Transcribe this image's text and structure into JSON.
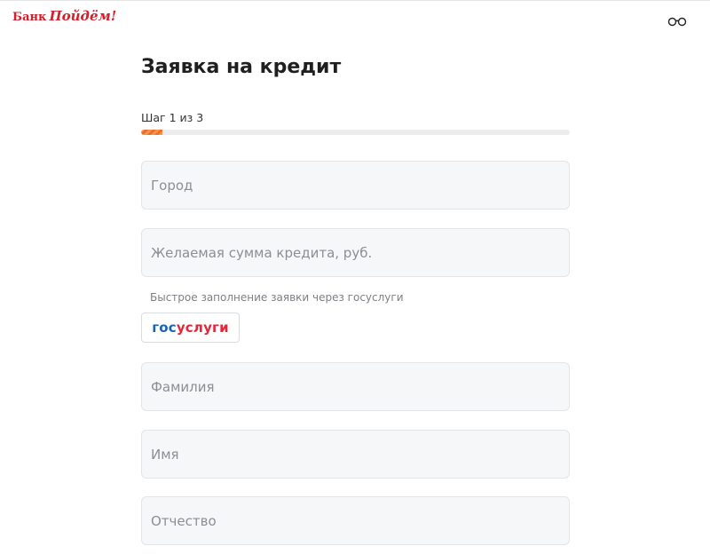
{
  "header": {
    "logo_word": "Банк",
    "logo_script": "Пойдём!",
    "accessibility_icon": "glasses-icon"
  },
  "form": {
    "title": "Заявка на кредит",
    "step_label": "Шаг 1 из 3",
    "progress": 0.05,
    "fields": [
      {
        "placeholder": "Город",
        "value": ""
      },
      {
        "placeholder": "Желаемая сумма кредита, руб.",
        "value": ""
      },
      {
        "placeholder": "Фамилия",
        "value": ""
      },
      {
        "placeholder": "Имя",
        "value": ""
      },
      {
        "placeholder": "Отчество",
        "value": ""
      }
    ],
    "gosuslugi": {
      "label": "Быстрое заполнение заявки через госуслуги",
      "button_part1": "гос",
      "button_part2": "услуги"
    }
  },
  "colors": {
    "brand_red": "#d3202c",
    "progress_orange": "#ee6d1f",
    "gos_blue": "#1a62b2",
    "gos_red": "#e4253a"
  }
}
